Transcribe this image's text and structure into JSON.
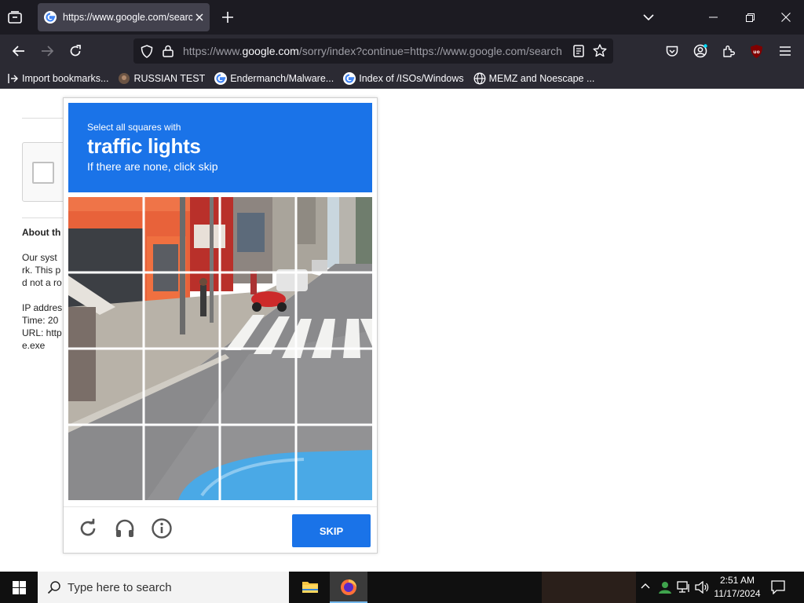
{
  "browser": {
    "tab": {
      "title": "https://www.google.com/searc"
    },
    "url": {
      "prefix": "https://www.",
      "domain": "google.com",
      "suffix": "/sorry/index?continue=https://www.google.com/search"
    },
    "bookmarks": [
      {
        "label": "Import bookmarks...",
        "icon": "import-icon"
      },
      {
        "label": "RUSSIAN TEST",
        "icon": "avatar-icon"
      },
      {
        "label": "Endermanch/Malware...",
        "icon": "google-icon"
      },
      {
        "label": "Index of /ISOs/Windows",
        "icon": "google-icon"
      },
      {
        "label": "MEMZ and Noescape ...",
        "icon": "globe-icon"
      }
    ]
  },
  "page": {
    "about": "About th",
    "lines": [
      "Our syst",
      "rk. This p",
      "d not a ro",
      "IP addres",
      "Time: 20",
      "URL: http",
      "e.exe"
    ]
  },
  "captcha": {
    "instruction": "Select all squares with",
    "target": "traffic lights",
    "hint": "If there are none, click skip",
    "skip_label": "SKIP",
    "colors": {
      "header": "#1a73e8",
      "button": "#1a73e8"
    }
  },
  "taskbar": {
    "search_placeholder": "Type here to search",
    "time": "2:51 AM",
    "date": "11/17/2024"
  }
}
